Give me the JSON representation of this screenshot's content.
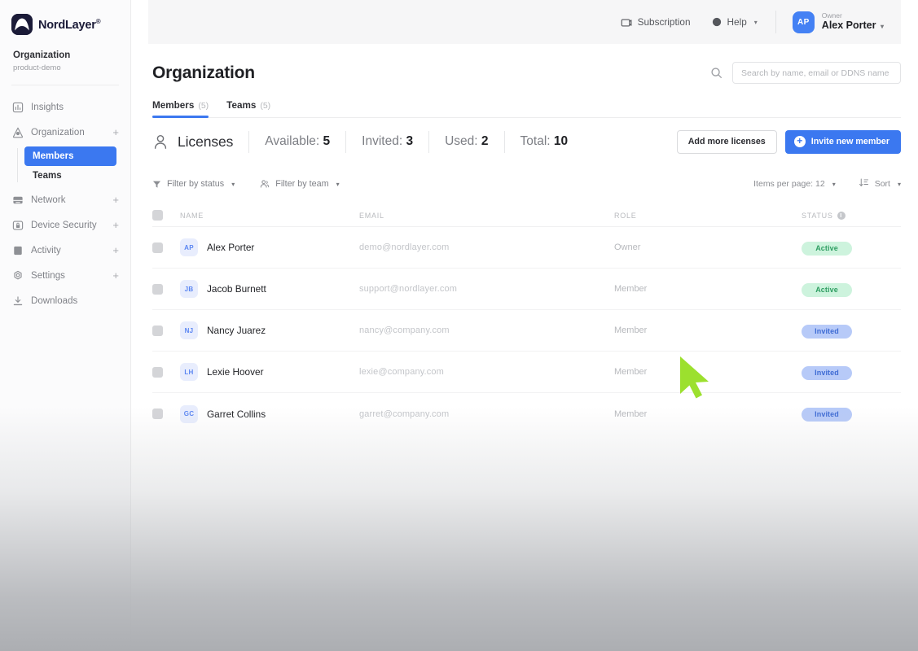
{
  "brand": {
    "logo_text": "NordLayer",
    "logo_tm": "®",
    "logo_icon": "nordlayer-logo-icon",
    "accent_color": "#3b78f0",
    "logo_bg": "#1b1b38"
  },
  "sidebar": {
    "org_name": "Organization",
    "org_sub": "product-demo",
    "items": [
      {
        "label": "Insights",
        "icon": "insights-icon",
        "expandable": false
      },
      {
        "label": "Organization",
        "icon": "organization-icon",
        "expandable": true,
        "plus": "+"
      },
      {
        "label": "Network",
        "icon": "network-icon",
        "expandable": true,
        "plus": "+"
      },
      {
        "label": "Device Security",
        "icon": "device-security-icon",
        "expandable": true,
        "plus": "+"
      },
      {
        "label": "Activity",
        "icon": "activity-icon",
        "expandable": true,
        "plus": "+"
      },
      {
        "label": "Settings",
        "icon": "settings-icon",
        "expandable": true,
        "plus": "+"
      },
      {
        "label": "Downloads",
        "icon": "downloads-icon",
        "expandable": false
      }
    ],
    "sub_items": [
      {
        "label": "Members",
        "active": true
      },
      {
        "label": "Teams",
        "active": false
      }
    ]
  },
  "topbar": {
    "subscription_label": "Subscription",
    "subscription_icon": "subscription-icon",
    "help_label": "Help",
    "help_icon": "help-icon",
    "user": {
      "initials": "AP",
      "role": "Owner",
      "name": "Alex Porter"
    }
  },
  "page": {
    "title": "Organization",
    "search_placeholder": "Search by name, email or DDNS name",
    "search_value": "",
    "search_icon": "search-icon"
  },
  "tabs": [
    {
      "label": "Members",
      "count": "(5)",
      "active": true
    },
    {
      "label": "Teams",
      "count": "(5)",
      "active": false
    }
  ],
  "licenses": {
    "icon": "person-icon",
    "title": "Licenses",
    "stats": [
      {
        "label": "Available:",
        "value": "5"
      },
      {
        "label": "Invited:",
        "value": "3"
      },
      {
        "label": "Used:",
        "value": "2"
      },
      {
        "label": "Total:",
        "value": "10"
      }
    ],
    "add_licenses_label": "Add more licenses",
    "invite_label": "Invite new member",
    "invite_icon": "plus-circle-icon"
  },
  "toolbar": {
    "filter_status_label": "Filter by status",
    "filter_status_icon": "funnel-icon",
    "filter_team_label": "Filter by team",
    "filter_team_icon": "people-icon",
    "items_per_page_label": "Items per page: 12",
    "sort_label": "Sort",
    "sort_icon": "sort-icon",
    "caret": "▾"
  },
  "table": {
    "columns": [
      "NAME",
      "EMAIL",
      "ROLE",
      "STATUS"
    ],
    "status_info_icon": "info-icon",
    "rows": [
      {
        "initials": "AP",
        "name": "Alex Porter",
        "email": "demo@nordlayer.com",
        "role": "Owner",
        "status": "Active",
        "status_kind": "active"
      },
      {
        "initials": "JB",
        "name": "Jacob Burnett",
        "email": "support@nordlayer.com",
        "role": "Member",
        "status": "Active",
        "status_kind": "active"
      },
      {
        "initials": "NJ",
        "name": "Nancy Juarez",
        "email": "nancy@company.com",
        "role": "Member",
        "status": "Invited",
        "status_kind": "invited"
      },
      {
        "initials": "LH",
        "name": "Lexie Hoover",
        "email": "lexie@company.com",
        "role": "Member",
        "status": "Invited",
        "status_kind": "invited"
      },
      {
        "initials": "GC",
        "name": "Garret Collins",
        "email": "garret@company.com",
        "role": "Member",
        "status": "Invited",
        "status_kind": "invited"
      }
    ]
  },
  "cursor": {
    "icon": "mouse-pointer-icon",
    "color": "#9ce02e"
  }
}
